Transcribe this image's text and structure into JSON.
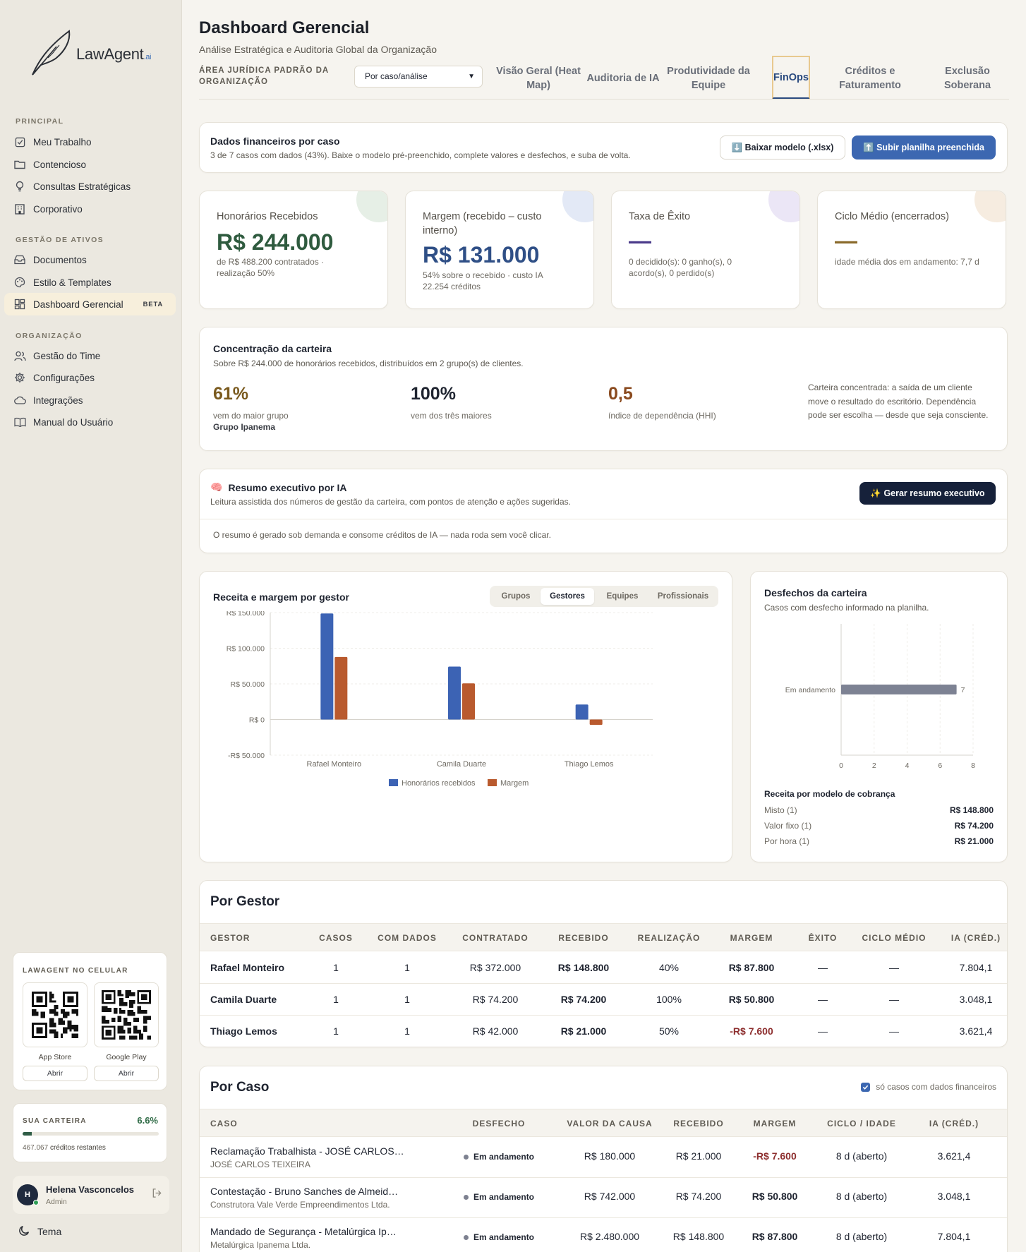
{
  "brand": {
    "name": "LawAgent",
    "suffix": ".ai"
  },
  "sidebar": {
    "sections": [
      {
        "title": "PRINCIPAL",
        "items": [
          {
            "label": "Meu Trabalho",
            "icon": "checklist-icon"
          },
          {
            "label": "Contencioso",
            "icon": "folder-icon"
          },
          {
            "label": "Consultas Estratégicas",
            "icon": "lightbulb-icon"
          },
          {
            "label": "Corporativo",
            "icon": "building-icon"
          }
        ]
      },
      {
        "title": "GESTÃO DE ATIVOS",
        "items": [
          {
            "label": "Documentos",
            "icon": "inbox-icon"
          },
          {
            "label": "Estilo & Templates",
            "icon": "palette-icon"
          },
          {
            "label": "Dashboard Gerencial",
            "icon": "dashboard-icon",
            "badge": "BETA",
            "active": true
          }
        ]
      },
      {
        "title": "ORGANIZAÇÃO",
        "items": [
          {
            "label": "Gestão do Time",
            "icon": "users-icon"
          },
          {
            "label": "Configurações",
            "icon": "gear-icon"
          },
          {
            "label": "Integrações",
            "icon": "cloud-icon"
          },
          {
            "label": "Manual do Usuário",
            "icon": "book-icon"
          }
        ]
      }
    ],
    "mobile": {
      "title": "LAWAGENT NO CELULAR",
      "stores": [
        {
          "label": "App Store",
          "button": "Abrir"
        },
        {
          "label": "Google Play",
          "button": "Abrir"
        }
      ]
    },
    "credits": {
      "title": "SUA CARTEIRA",
      "percent": "6.6%",
      "fill": 0.066,
      "remaining": "467.067",
      "remaining_label": "créditos restantes"
    },
    "user": {
      "initial": "H",
      "name": "Helena Vasconcelos",
      "role": "Admin"
    },
    "theme_label": "Tema"
  },
  "header": {
    "title": "Dashboard Gerencial",
    "subtitle": "Análise Estratégica e Auditoria Global da Organização",
    "area_label": "ÁREA JURÍDICA PADRÃO DA ORGANIZAÇÃO",
    "area_value": "Por caso/análise",
    "tabs": [
      {
        "label": "Visão Geral (Heat Map)"
      },
      {
        "label": "Auditoria de IA"
      },
      {
        "label": "Produtividade da Equipe"
      },
      {
        "label": "FinOps",
        "active": true
      },
      {
        "label": "Créditos e Faturamento"
      },
      {
        "label": "Exclusão Soberana"
      }
    ]
  },
  "financial_data": {
    "title": "Dados financeiros por caso",
    "desc": "3 de 7 casos com dados (43%). Baixe o modelo pré-preenchido, complete valores e desfechos, e suba de volta.",
    "download_label": "⬇️ Baixar modelo (.xlsx)",
    "upload_label": "⬆️ Subir planilha preenchida"
  },
  "kpis": [
    {
      "label": "Honorários Recebidos",
      "value": "R$ 244.000",
      "note": "de R$ 488.200 contratados · realização 50%",
      "value_color": "#2f5b3f",
      "blob": "#e6efe6"
    },
    {
      "label": "Margem (recebido – custo interno)",
      "value": "R$ 131.000",
      "note": "54% sobre o recebido · custo IA 22.254 créditos",
      "value_color": "#2f4f86",
      "blob": "#e3e9f6"
    },
    {
      "label": "Taxa de Êxito",
      "value": "—",
      "note": "0 decidido(s): 0 ganho(s), 0 acordo(s), 0 perdido(s)",
      "value_color": "#4a3a8a",
      "blob": "#ebe6f6"
    },
    {
      "label": "Ciclo Médio (encerrados)",
      "value": "—",
      "note": "idade média dos em andamento: 7,7 d",
      "value_color": "#8a6a2a",
      "blob": "#f6ece0"
    }
  ],
  "concentration": {
    "title": "Concentração da carteira",
    "subtitle": "Sobre R$ 244.000 de honorários recebidos, distribuídos em 2 grupo(s) de clientes.",
    "stats": [
      {
        "value": "61%",
        "caption": "vem do maior grupo",
        "extra": "Grupo Ipanema",
        "color": "#7a5a1e"
      },
      {
        "value": "100%",
        "caption": "vem dos três maiores",
        "color": "#1f2430"
      },
      {
        "value": "0,5",
        "caption": "índice de dependência (HHI)",
        "color": "#8a4a1e"
      }
    ],
    "note": "Carteira concentrada: a saída de um cliente move o resultado do escritório. Dependência pode ser escolha — desde que seja consciente."
  },
  "ai_summary": {
    "emoji": "🧠",
    "title": "Resumo executivo por IA",
    "subtitle": "Leitura assistida dos números de gestão da carteira, com pontos de atenção e ações sugeridas.",
    "button": "✨ Gerar resumo executivo",
    "footer": "O resumo é gerado sob demanda e consome créditos de IA — nada roda sem você clicar."
  },
  "revenue_chart": {
    "title": "Receita e margem por gestor",
    "segments": [
      "Grupos",
      "Gestores",
      "Equipes",
      "Profissionais"
    ],
    "active_segment": 1
  },
  "outcomes": {
    "title": "Desfechos da carteira",
    "subtitle": "Casos com desfecho informado na planilha.",
    "billing_title": "Receita por modelo de cobrança",
    "billing": [
      {
        "label": "Misto (1)",
        "value": "R$ 148.800"
      },
      {
        "label": "Valor fixo (1)",
        "value": "R$ 74.200"
      },
      {
        "label": "Por hora (1)",
        "value": "R$ 21.000"
      }
    ]
  },
  "chart_data": [
    {
      "type": "bar",
      "title": "Receita e margem por gestor",
      "categories": [
        "Rafael Monteiro",
        "Camila Duarte",
        "Thiago Lemos"
      ],
      "series": [
        {
          "name": "Honorários recebidos",
          "values": [
            148800,
            74200,
            21000
          ],
          "color": "#3c63b4"
        },
        {
          "name": "Margem",
          "values": [
            87800,
            50800,
            -7600
          ],
          "color": "#b95a2e"
        }
      ],
      "ylim": [
        -50000,
        150000
      ],
      "yticks": [
        "R$ 150.000",
        "R$ 100.000",
        "R$ 50.000",
        "R$ 0",
        "-R$ 50.000"
      ],
      "ytick_values": [
        150000,
        100000,
        50000,
        0,
        -50000
      ],
      "legend": "bottom",
      "grid": true
    },
    {
      "type": "bar",
      "orientation": "horizontal",
      "title": "Desfechos da carteira",
      "categories": [
        "Em andamento"
      ],
      "values": [
        7
      ],
      "data_labels": [
        "7"
      ],
      "xlim": [
        0,
        8
      ],
      "xticks": [
        "0",
        "2",
        "4",
        "6",
        "8"
      ],
      "xtick_values": [
        0,
        2,
        4,
        6,
        8
      ],
      "color": "#7d8293",
      "grid": true
    }
  ],
  "by_manager": {
    "title": "Por Gestor",
    "columns": [
      "GESTOR",
      "CASOS",
      "COM DADOS",
      "CONTRATADO",
      "RECEBIDO",
      "REALIZAÇÃO",
      "MARGEM",
      "ÊXITO",
      "CICLO MÉDIO",
      "IA (CRÉD.)"
    ],
    "rows": [
      [
        "Rafael Monteiro",
        "1",
        "1",
        "R$ 372.000",
        "R$ 148.800",
        "40%",
        "R$ 87.800",
        "—",
        "—",
        "7.804,1"
      ],
      [
        "Camila Duarte",
        "1",
        "1",
        "R$ 74.200",
        "R$ 74.200",
        "100%",
        "R$ 50.800",
        "—",
        "—",
        "3.048,1"
      ],
      [
        "Thiago Lemos",
        "1",
        "1",
        "R$ 42.000",
        "R$ 21.000",
        "50%",
        "-R$ 7.600",
        "—",
        "—",
        "3.621,4"
      ]
    ]
  },
  "by_case": {
    "title": "Por Caso",
    "filter_label": "só casos com dados financeiros",
    "columns": [
      "CASO",
      "DESFECHO",
      "VALOR DA CAUSA",
      "RECEBIDO",
      "MARGEM",
      "CICLO / IDADE",
      "IA (CRÉD.)"
    ],
    "rows": [
      {
        "case": "Reclamação Trabalhista - JOSÉ CARLOS…",
        "client": "JOSÉ CARLOS TEIXEIRA",
        "status": "Em andamento",
        "cause": "R$ 180.000",
        "received": "R$ 21.000",
        "margin": "-R$ 7.600",
        "cycle": "8 d (aberto)",
        "ai": "3.621,4"
      },
      {
        "case": "Contestação - Bruno Sanches de Almeid…",
        "client": "Construtora Vale Verde Empreendimentos Ltda.",
        "status": "Em andamento",
        "cause": "R$ 742.000",
        "received": "R$ 74.200",
        "margin": "R$ 50.800",
        "cycle": "8 d (aberto)",
        "ai": "3.048,1"
      },
      {
        "case": "Mandado de Segurança - Metalúrgica Ip…",
        "client": "Metalúrgica Ipanema Ltda.",
        "status": "Em andamento",
        "cause": "R$ 2.480.000",
        "received": "R$ 148.800",
        "margin": "R$ 87.800",
        "cycle": "8 d (aberto)",
        "ai": "7.804,1"
      }
    ]
  }
}
